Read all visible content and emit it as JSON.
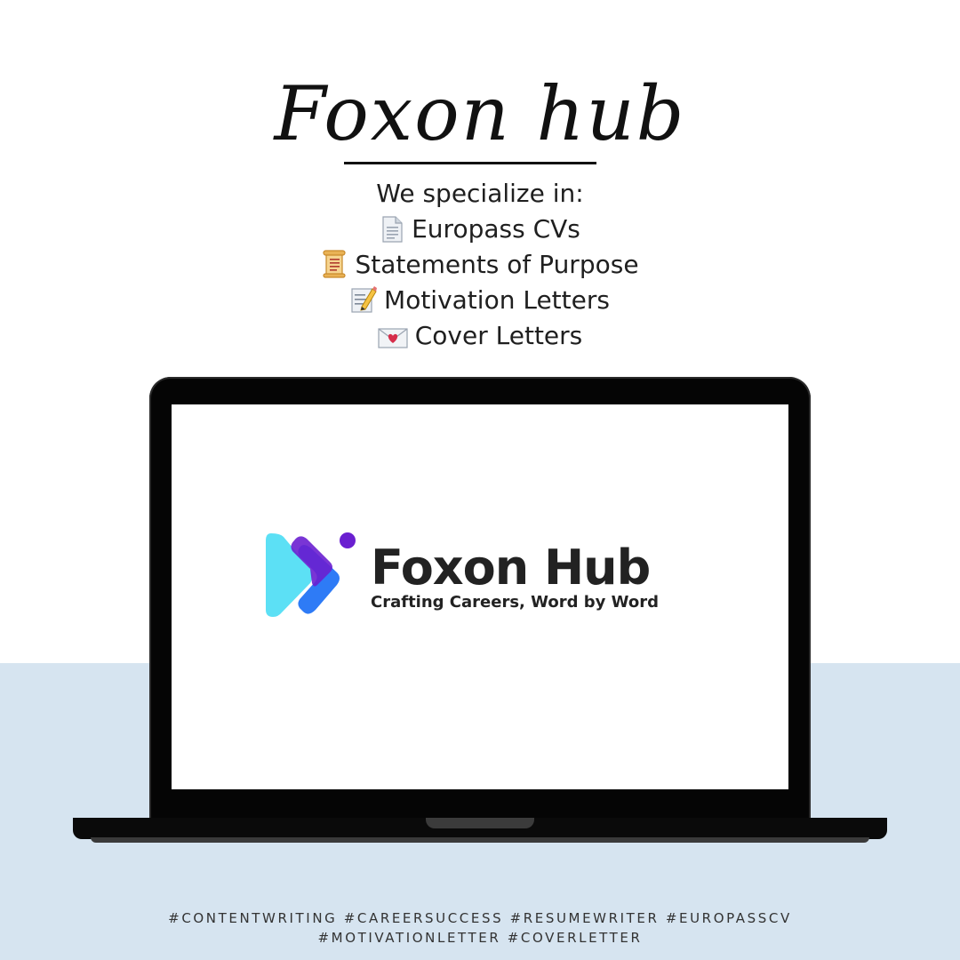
{
  "header": {
    "script_title": "Foxon hub",
    "intro": "We specialize in:"
  },
  "services": [
    {
      "icon": "page-icon",
      "label": "Europass CVs"
    },
    {
      "icon": "scroll-icon",
      "label": "Statements of Purpose"
    },
    {
      "icon": "memo-pencil-icon",
      "label": "Motivation Letters"
    },
    {
      "icon": "love-letter-icon",
      "label": "Cover Letters"
    }
  ],
  "screen": {
    "brand_name": "Foxon Hub",
    "tagline": "Crafting Careers, Word by Word"
  },
  "hashtags": {
    "line1": "#CONTENTWRITING #CAREERSUCCESS #RESUMEWRITER #EUROPASSCV",
    "line2": "#MOTIVATIONLETTER #COVERLETTER"
  },
  "colors": {
    "background": "#ffffff",
    "band": "#d6e4f0",
    "laptop": "#050505",
    "logo_cyan": "#5ce0f5",
    "logo_blue": "#2e7bf6",
    "logo_purple": "#6a1fd0"
  }
}
